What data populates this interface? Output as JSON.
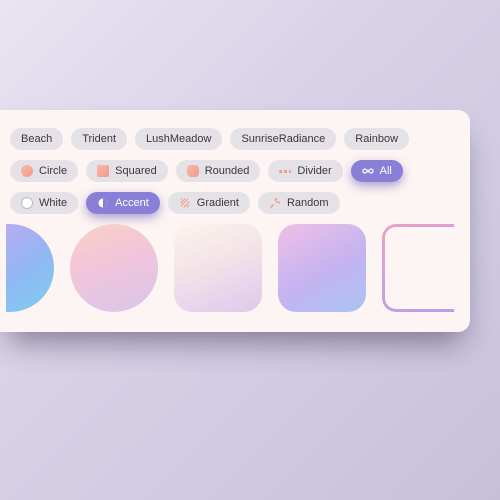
{
  "palettes": {
    "items": [
      "Beach",
      "Trident",
      "LushMeadow",
      "SunriseRadiance",
      "Rainbow"
    ]
  },
  "shapes": {
    "items": [
      {
        "label": "Circle"
      },
      {
        "label": "Squared"
      },
      {
        "label": "Rounded"
      },
      {
        "label": "Divider"
      },
      {
        "label": "All",
        "active": true
      }
    ]
  },
  "fills": {
    "items": [
      {
        "label": "White"
      },
      {
        "label": "Accent",
        "active": true
      },
      {
        "label": "Gradient"
      },
      {
        "label": "Random"
      }
    ]
  }
}
